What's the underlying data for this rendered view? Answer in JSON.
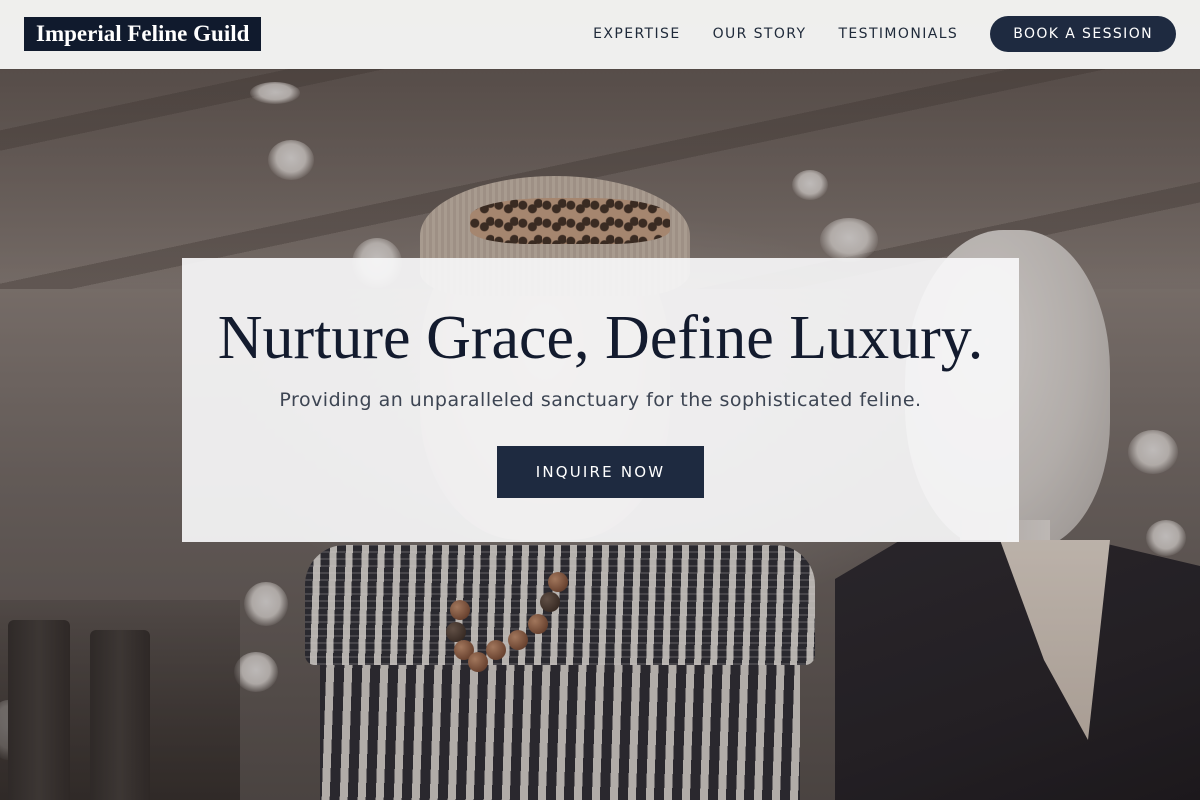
{
  "brand": {
    "logo_text": "Imperial Feline Guild"
  },
  "nav": {
    "links": [
      {
        "label": "EXPERTISE"
      },
      {
        "label": "OUR STORY"
      },
      {
        "label": "TESTIMONIALS"
      }
    ],
    "cta_label": "BOOK A SESSION"
  },
  "hero": {
    "title": "Nurture Grace, Define Luxury.",
    "subtitle": "Providing an unparalleled sanctuary for the sophisticated feline.",
    "button_label": "INQUIRE NOW"
  },
  "colors": {
    "navy": "#1e2a40",
    "logo_bg": "#101a2d",
    "header_bg": "#f5f5f4",
    "card_bg": "#f7f7f8"
  }
}
